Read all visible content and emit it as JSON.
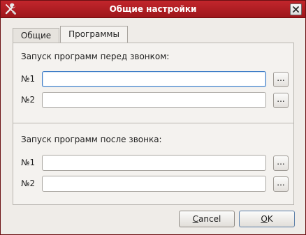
{
  "window": {
    "title": "Общие настройки",
    "icon": "wrench-screwdriver-icon",
    "close_symbol": "✕"
  },
  "tabs": [
    {
      "label": "Общие",
      "active": false
    },
    {
      "label": "Программы",
      "active": true
    }
  ],
  "before_call": {
    "label": "Запуск программ перед звонком:",
    "rows": [
      {
        "label": "№1",
        "value": "",
        "browse": "..."
      },
      {
        "label": "№2",
        "value": "",
        "browse": "..."
      }
    ]
  },
  "after_call": {
    "label": "Запуск программ после звонка:",
    "rows": [
      {
        "label": "№1",
        "value": "",
        "browse": "..."
      },
      {
        "label": "№2",
        "value": "",
        "browse": "..."
      }
    ]
  },
  "buttons": {
    "cancel_mnemonic": "C",
    "cancel_rest": "ancel",
    "ok_mnemonic": "O",
    "ok_rest": "K"
  },
  "colors": {
    "titlebar": "#b01e24",
    "focus": "#3d7cc6"
  }
}
